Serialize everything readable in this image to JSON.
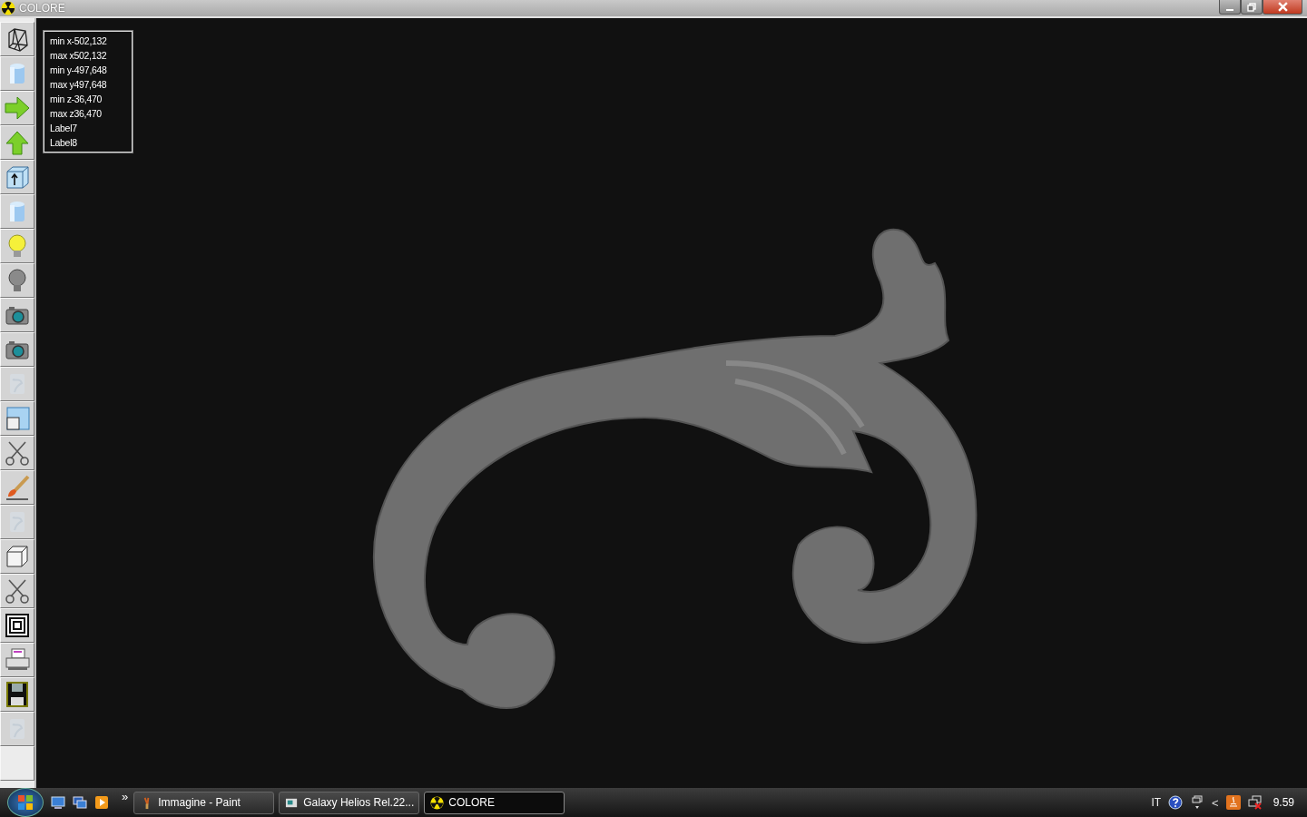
{
  "window": {
    "title": "COLORE"
  },
  "toolbar": [
    {
      "kind": "wireframe",
      "disabled": false
    },
    {
      "kind": "cylinder",
      "disabled": false
    },
    {
      "kind": "arrow-right",
      "disabled": false
    },
    {
      "kind": "arrow-up",
      "disabled": false
    },
    {
      "kind": "box-arrow",
      "disabled": false
    },
    {
      "kind": "cylinder",
      "disabled": false
    },
    {
      "kind": "bulb-on",
      "disabled": false
    },
    {
      "kind": "bulb-off",
      "disabled": false
    },
    {
      "kind": "camera",
      "disabled": false
    },
    {
      "kind": "camera",
      "disabled": false
    },
    {
      "kind": "texture",
      "disabled": true
    },
    {
      "kind": "window",
      "disabled": false
    },
    {
      "kind": "scissors",
      "disabled": false
    },
    {
      "kind": "brush",
      "disabled": false
    },
    {
      "kind": "texture",
      "disabled": true
    },
    {
      "kind": "cube",
      "disabled": false
    },
    {
      "kind": "scissors",
      "disabled": false
    },
    {
      "kind": "target",
      "disabled": false
    },
    {
      "kind": "printer",
      "disabled": false
    },
    {
      "kind": "floppy",
      "disabled": false
    },
    {
      "kind": "texture",
      "disabled": true
    }
  ],
  "info_labels": [
    "min x-502,132",
    "max x502,132",
    "min y-497,648",
    "max y497,648",
    "min z-36,470",
    "max z36,470",
    "Label7",
    "Label8"
  ],
  "taskbar": {
    "overflow": "»",
    "tasks": [
      {
        "label": "Immagine - Paint",
        "kind": "paint",
        "selected": false
      },
      {
        "label": "Galaxy Helios  Rel.22...",
        "kind": "app",
        "selected": false
      },
      {
        "label": "COLORE",
        "kind": "radiation",
        "selected": true
      }
    ],
    "language": "IT",
    "clock": "9.59",
    "tray_arrow": "<"
  }
}
